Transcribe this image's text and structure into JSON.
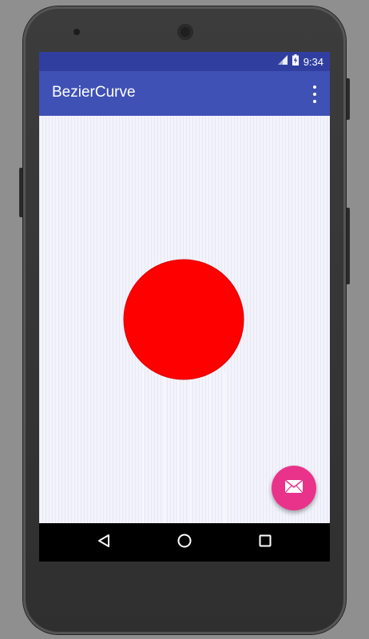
{
  "status_bar": {
    "time": "9:34",
    "signal_icon": "cell-signal-icon",
    "battery_icon": "battery-charging-icon",
    "color": "#303f9f"
  },
  "app_bar": {
    "title": "BezierCurve",
    "overflow_icon": "overflow-menu-icon",
    "color": "#3f51b5"
  },
  "canvas": {
    "shape": "red-circle",
    "fill_color": "#ff0000"
  },
  "fab": {
    "icon": "mail-icon",
    "color": "#e9338b"
  },
  "nav_bar": {
    "back_icon": "back-icon",
    "home_icon": "home-icon",
    "recents_icon": "recents-icon"
  }
}
